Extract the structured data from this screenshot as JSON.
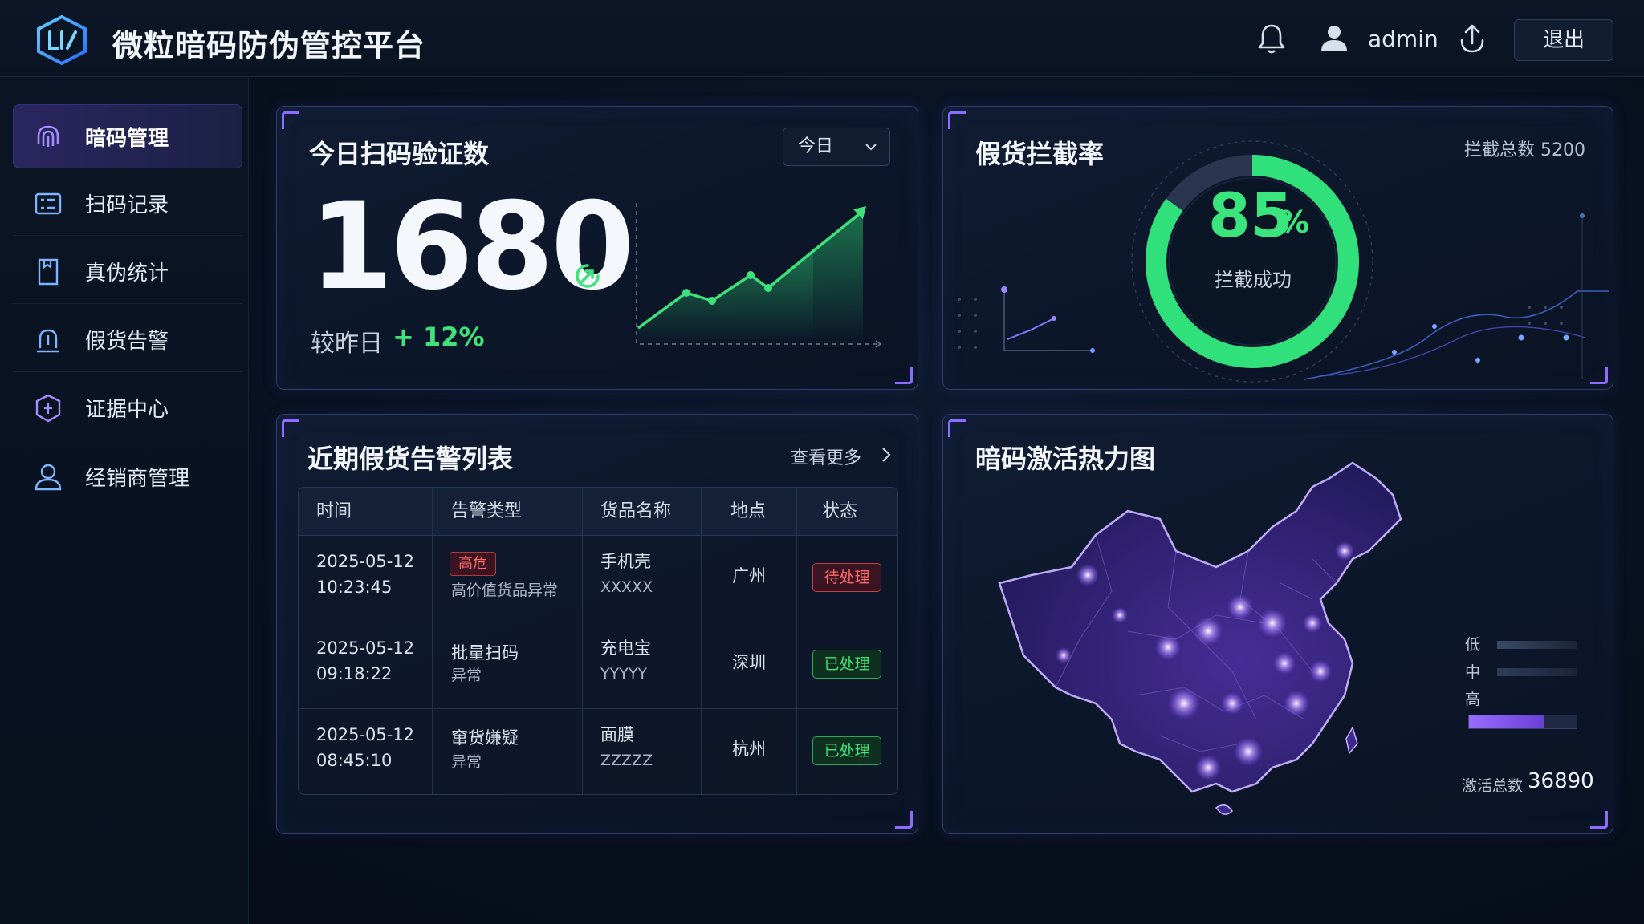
{
  "header": {
    "title": "微粒暗码防伪管控平台",
    "username": "admin",
    "logout_label": "退出"
  },
  "sidebar": {
    "items": [
      {
        "label": "暗码管理",
        "icon": "fingerprint-icon"
      },
      {
        "label": "扫码记录",
        "icon": "scan-record-icon"
      },
      {
        "label": "真伪统计",
        "icon": "bookmark-icon"
      },
      {
        "label": "假货告警",
        "icon": "alarm-icon"
      },
      {
        "label": "证据中心",
        "icon": "shield-icon"
      },
      {
        "label": "经销商管理",
        "icon": "user-icon"
      }
    ]
  },
  "scan_panel": {
    "title": "今日扫码验证数",
    "period": "今日",
    "value": "1680",
    "compare_label": "较昨日",
    "compare_value": "+ 12%"
  },
  "intercept_panel": {
    "title": "假货拦截率",
    "total_label": "拦截总数 5200",
    "percent": "85",
    "percent_unit": "%",
    "percent_fraction": 0.85,
    "caption": "拦截成功"
  },
  "alert_panel": {
    "title": "近期假货告警列表",
    "more_label": "查看更多",
    "columns": [
      "时间",
      "告警类型",
      "货品名称",
      "地点",
      "状态"
    ],
    "rows": [
      {
        "date": "2025-05-12",
        "time": "10:23:45",
        "type_tag": "高危",
        "type_line1": "",
        "type_line2": "高价值货品异常",
        "product": "手机壳",
        "code": "XXXXX",
        "location": "广州",
        "status": "待处理",
        "status_kind": "pending"
      },
      {
        "date": "2025-05-12",
        "time": "09:18:22",
        "type_tag": "",
        "type_line1": "批量扫码",
        "type_line2": "异常",
        "product": "充电宝",
        "code": "YYYYY",
        "location": "深圳",
        "status": "已处理",
        "status_kind": "done"
      },
      {
        "date": "2025-05-12",
        "time": "08:45:10",
        "type_tag": "",
        "type_line1": "窜货嫌疑",
        "type_line2": "异常",
        "product": "面膜",
        "code": "ZZZZZ",
        "location": "杭州",
        "status": "已处理",
        "status_kind": "done"
      }
    ]
  },
  "heatmap_panel": {
    "title": "暗码激活热力图",
    "legend": [
      "低",
      "中",
      "高"
    ],
    "activation_label": "激活总数",
    "activation_value": "36890"
  },
  "colors": {
    "accent_purple": "#8d6bff",
    "success_green": "#3be57e",
    "danger_red": "#ff6a6a"
  }
}
